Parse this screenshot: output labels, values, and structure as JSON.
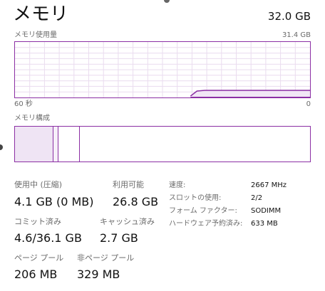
{
  "header": {
    "title": "メモリ",
    "total": "32.0 GB"
  },
  "usage_graph": {
    "label": "メモリ使用量",
    "max_label": "31.4 GB",
    "time_left": "60 秒",
    "time_right": "0",
    "line_color": "#8b2fa4",
    "fill_color": "#f1e6f5"
  },
  "composition": {
    "label": "メモリ構成",
    "used_fraction": 0.131,
    "modified_fraction": 0.016,
    "standby_fraction": 0.073
  },
  "stats": {
    "in_use_label": "使用中 (圧縮)",
    "in_use_value": "4.1 GB (0 MB)",
    "available_label": "利用可能",
    "available_value": "26.8 GB",
    "committed_label": "コミット済み",
    "committed_value": "4.6/36.1 GB",
    "cached_label": "キャッシュ済み",
    "cached_value": "2.7 GB",
    "paged_pool_label": "ページ プール",
    "paged_pool_value": "206 MB",
    "nonpaged_pool_label": "非ページ プール",
    "nonpaged_pool_value": "329 MB"
  },
  "info": {
    "speed_label": "速度:",
    "speed_value": "2667 MHz",
    "slots_label": "スロットの使用:",
    "slots_value": "2/2",
    "form_factor_label": "フォーム ファクター:",
    "form_factor_value": "SODIMM",
    "hw_reserved_label": "ハードウェア予約済み:",
    "hw_reserved_value": "633 MB"
  }
}
